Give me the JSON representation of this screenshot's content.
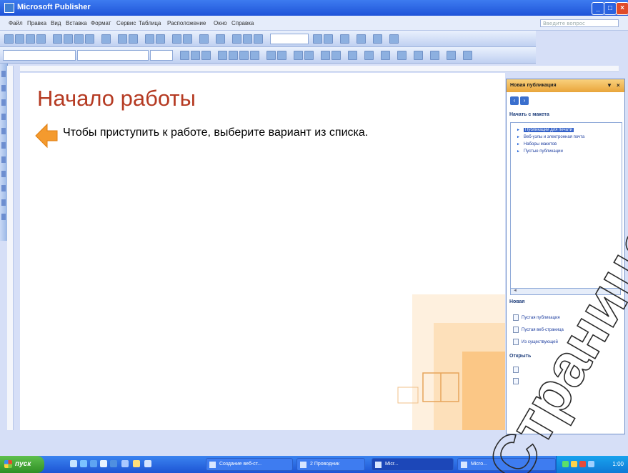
{
  "window": {
    "title": "Microsoft Publisher"
  },
  "menu": [
    "Файл",
    "Правка",
    "Вид",
    "Вставка",
    "Формат",
    "Сервис",
    "Таблица",
    "Расположение",
    "Окно",
    "Справка"
  ],
  "help_placeholder": "Введите вопрос",
  "workspace": {
    "heading": "Начало работы",
    "prompt": "Чтобы приступить к работе, выберите вариант из списка."
  },
  "taskpane": {
    "title": "Новая публикация",
    "section_start": "Начать с макета",
    "items": [
      "Публикации для печати",
      "Веб-узлы и электронная почта",
      "Наборы макетов",
      "Пустые публикации"
    ],
    "section_new": "Новая",
    "new_items": [
      "Пустая публикация",
      "Пустая веб-страница",
      "Из существующей"
    ],
    "section_open": "Открыть"
  },
  "taskbar": {
    "start": "пуск",
    "buttons": [
      "Создание веб-ст...",
      "2 Проводник",
      "Micr...",
      "Micro..."
    ],
    "clock": "1:00"
  },
  "watermark": "Страница"
}
